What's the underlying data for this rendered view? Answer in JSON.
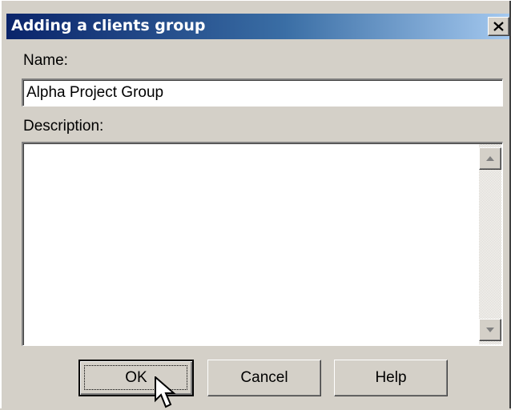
{
  "dialog": {
    "title": "Adding a clients group",
    "close_glyph": "✕",
    "close_icon": "close-icon"
  },
  "fields": {
    "name_label": "Name:",
    "name_value": "Alpha Project Group",
    "description_label": "Description:",
    "description_value": ""
  },
  "buttons": {
    "ok_label": "OK",
    "cancel_label": "Cancel",
    "help_label": "Help"
  },
  "colors": {
    "title_start": "#0a246a",
    "title_end": "#a6caf0",
    "face": "#d4d0c8"
  }
}
